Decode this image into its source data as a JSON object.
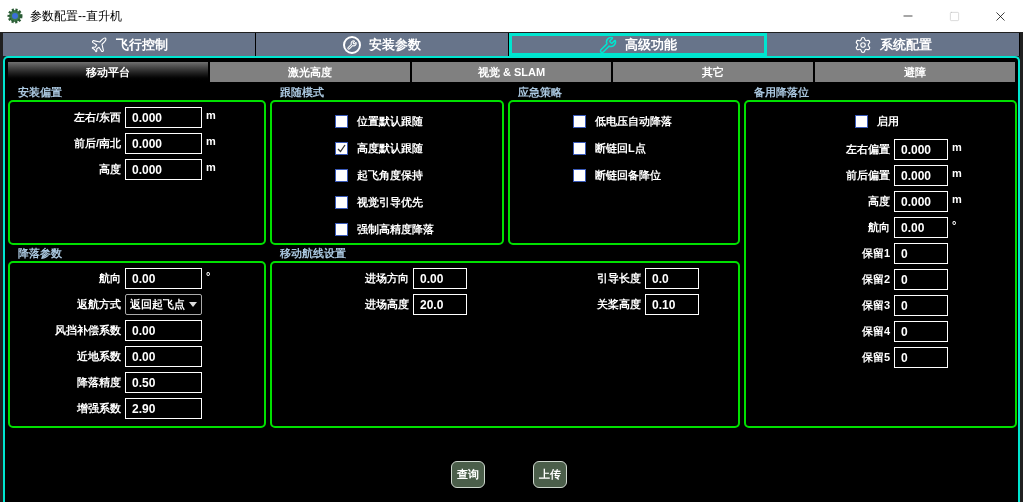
{
  "window": {
    "title": "参数配置--直升机"
  },
  "main_tabs": [
    {
      "label": "飞行控制",
      "selected": false
    },
    {
      "label": "安装参数",
      "selected": false
    },
    {
      "label": "高级功能",
      "selected": true
    },
    {
      "label": "系统配置",
      "selected": false
    }
  ],
  "sub_tabs": [
    {
      "label": "移动平台",
      "selected": true
    },
    {
      "label": "激光高度",
      "selected": false
    },
    {
      "label": "视觉 & SLAM",
      "selected": false
    },
    {
      "label": "其它",
      "selected": false
    },
    {
      "label": "避障",
      "selected": false
    }
  ],
  "install_offset": {
    "title": "安装偏置",
    "fields": [
      {
        "label": "左右/东西",
        "value": "0.000",
        "unit": "m"
      },
      {
        "label": "前后/南北",
        "value": "0.000",
        "unit": "m"
      },
      {
        "label": "高度",
        "value": "0.000",
        "unit": "m"
      }
    ]
  },
  "follow_mode": {
    "title": "跟随模式",
    "options": [
      {
        "label": "位置默认跟随",
        "checked": false
      },
      {
        "label": "高度默认跟随",
        "checked": true
      },
      {
        "label": "起飞角度保持",
        "checked": false
      },
      {
        "label": "视觉引导优先",
        "checked": false
      },
      {
        "label": "强制高精度降落",
        "checked": false
      }
    ]
  },
  "emergency": {
    "title": "应急策略",
    "options": [
      {
        "label": "低电压自动降落",
        "checked": false
      },
      {
        "label": "断链回L点",
        "checked": false
      },
      {
        "label": "断链回备降位",
        "checked": false
      }
    ]
  },
  "backup_landing": {
    "title": "备用降落位",
    "enable": {
      "label": "启用",
      "checked": false
    },
    "fields": [
      {
        "label": "左右偏置",
        "value": "0.000",
        "unit": "m"
      },
      {
        "label": "前后偏置",
        "value": "0.000",
        "unit": "m"
      },
      {
        "label": "高度",
        "value": "0.000",
        "unit": "m"
      },
      {
        "label": "航向",
        "value": "0.00",
        "unit": "°"
      },
      {
        "label": "保留1",
        "value": "0"
      },
      {
        "label": "保留2",
        "value": "0"
      },
      {
        "label": "保留3",
        "value": "0"
      },
      {
        "label": "保留4",
        "value": "0"
      },
      {
        "label": "保留5",
        "value": "0"
      }
    ]
  },
  "landing_params": {
    "title": "降落参数",
    "fields": [
      {
        "kind": "input",
        "label": "航向",
        "value": "0.00",
        "unit": "°"
      },
      {
        "kind": "select",
        "label": "返航方式",
        "value": "返回起飞点"
      },
      {
        "kind": "input",
        "label": "风挡补偿系数",
        "value": "0.00"
      },
      {
        "kind": "input",
        "label": "近地系数",
        "value": "0.00"
      },
      {
        "kind": "input",
        "label": "降落精度",
        "value": "0.50"
      },
      {
        "kind": "input",
        "label": "增强系数",
        "value": "2.90"
      }
    ]
  },
  "moving_route": {
    "title": "移动航线设置",
    "fields_left": [
      {
        "label": "进场方向",
        "value": "0.00"
      },
      {
        "label": "进场高度",
        "value": "20.0"
      }
    ],
    "fields_right": [
      {
        "label": "引导长度",
        "value": "0.0"
      },
      {
        "label": "关桨高度",
        "value": "0.10"
      }
    ]
  },
  "buttons": [
    "查询",
    "上传"
  ]
}
